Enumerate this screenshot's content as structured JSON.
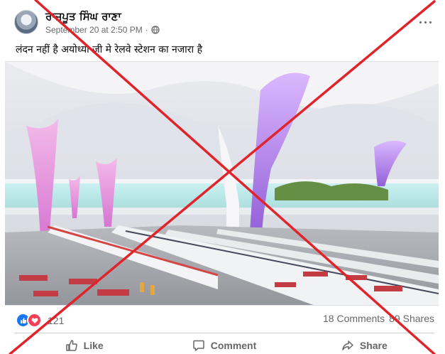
{
  "post": {
    "author": "ਰਾਜਪੂਤ ਸਿੰਘ ਰਾਣਾ",
    "timestamp": "September 20 at 2:50 PM",
    "separator": "·",
    "privacy_icon": "globe-icon",
    "caption": "लंदन नहीं है अयोध्या जी मे रेलवे स्टेशन का नजारा है"
  },
  "stats": {
    "reaction_icons": [
      "like-reaction-icon",
      "love-reaction-icon"
    ],
    "reaction_count": "121",
    "comments": "18 Comments",
    "shares": "89 Shares"
  },
  "actions": {
    "like": "Like",
    "comment": "Comment",
    "share": "Share"
  },
  "overlay": {
    "cross_color": "#e0242c"
  }
}
